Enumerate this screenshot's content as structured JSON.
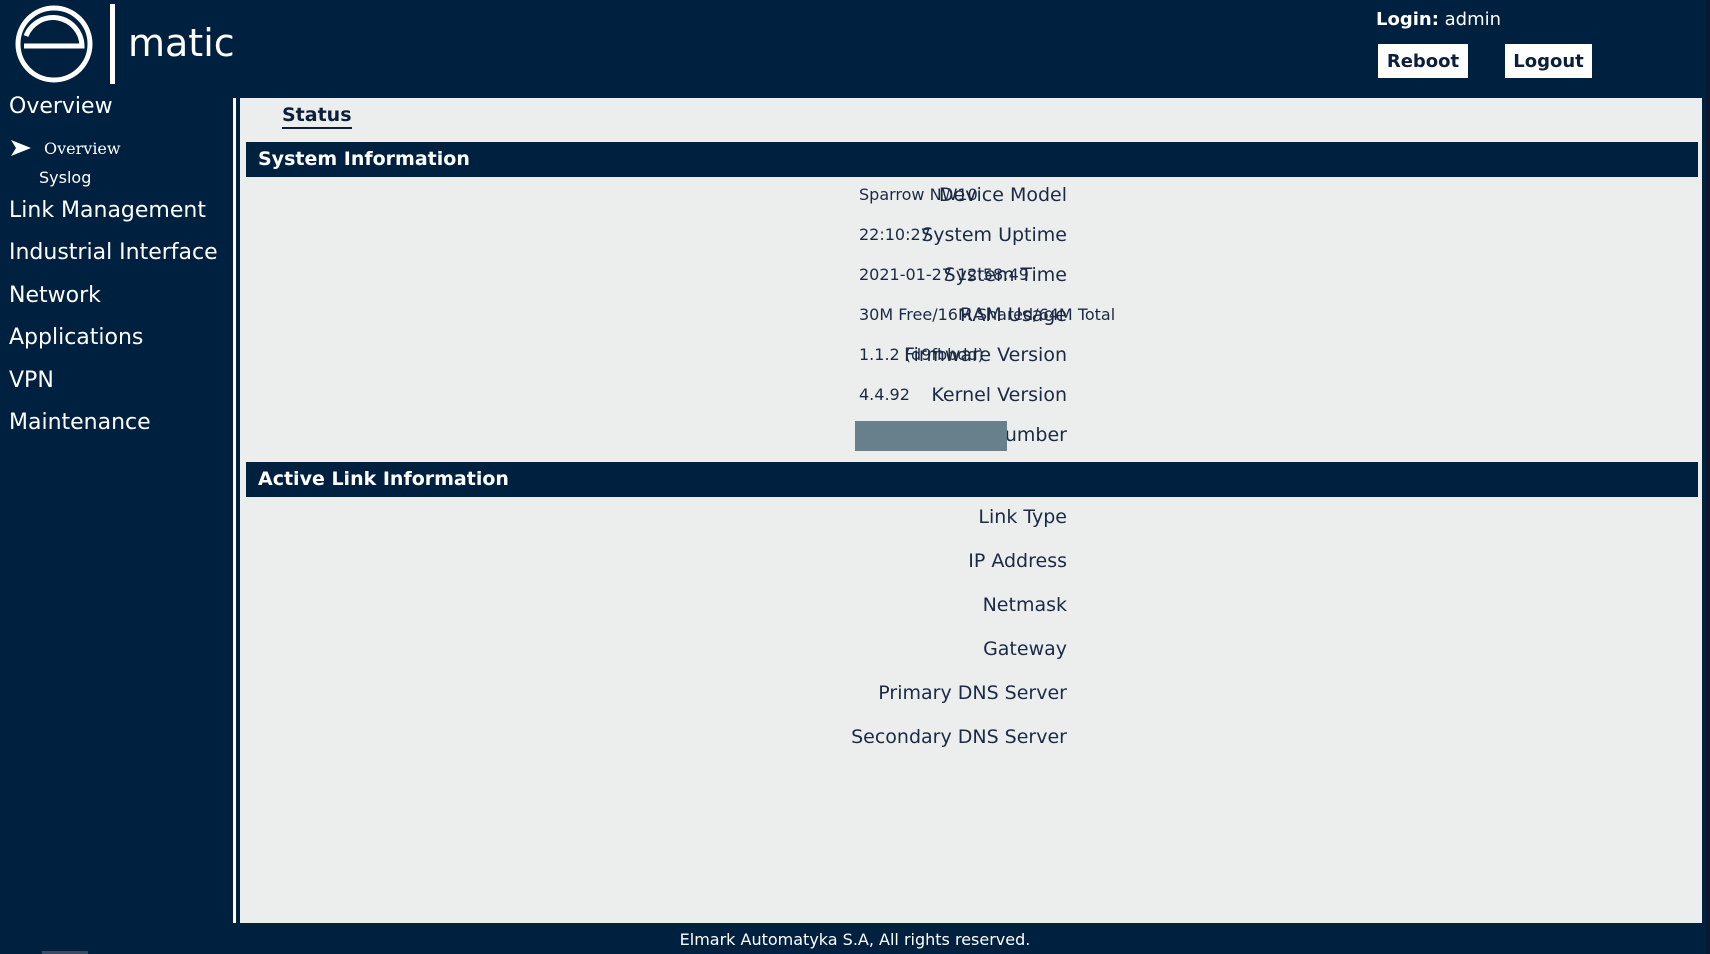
{
  "header": {
    "logo_text": "matic",
    "logo_letter": "e",
    "login_label": "Login:",
    "login_user": "admin",
    "reboot_label": "Reboot",
    "logout_label": "Logout"
  },
  "sidebar": {
    "items": [
      {
        "label": "Overview"
      },
      {
        "label": "Link Management"
      },
      {
        "label": "Industrial Interface"
      },
      {
        "label": "Network"
      },
      {
        "label": "Applications"
      },
      {
        "label": "VPN"
      },
      {
        "label": "Maintenance"
      }
    ],
    "sub_items": [
      {
        "label": "Overview",
        "active": true
      },
      {
        "label": "Syslog",
        "active": false
      }
    ]
  },
  "main": {
    "tab_label": "Status",
    "system_info": {
      "title": "System Information",
      "rows": [
        {
          "label": "Device Model",
          "value": "Sparrow NW10"
        },
        {
          "label": "System Uptime",
          "value": "22:10:27"
        },
        {
          "label": "System Time",
          "value": "2021-01-27 12:58:49"
        },
        {
          "label": "RAM Usage",
          "value": "30M Free/16M Shared/64M Total"
        },
        {
          "label": "Firmware Version",
          "value": "1.1.2 (d9fbbdd)"
        },
        {
          "label": "Kernel Version",
          "value": "4.4.92"
        },
        {
          "label": "Serial Number",
          "value": ""
        }
      ]
    },
    "link_info": {
      "title": "Active Link Information",
      "rows": [
        {
          "label": "Link Type",
          "value": ""
        },
        {
          "label": "IP Address",
          "value": ""
        },
        {
          "label": "Netmask",
          "value": ""
        },
        {
          "label": "Gateway",
          "value": ""
        },
        {
          "label": "Primary DNS Server",
          "value": ""
        },
        {
          "label": "Secondary DNS Server",
          "value": ""
        }
      ]
    }
  },
  "footer": {
    "text": "Elmark Automatyka S.A, All rights reserved."
  },
  "colors": {
    "background": "#00203f",
    "content": "#eceeee",
    "redaction": "#67808b"
  }
}
